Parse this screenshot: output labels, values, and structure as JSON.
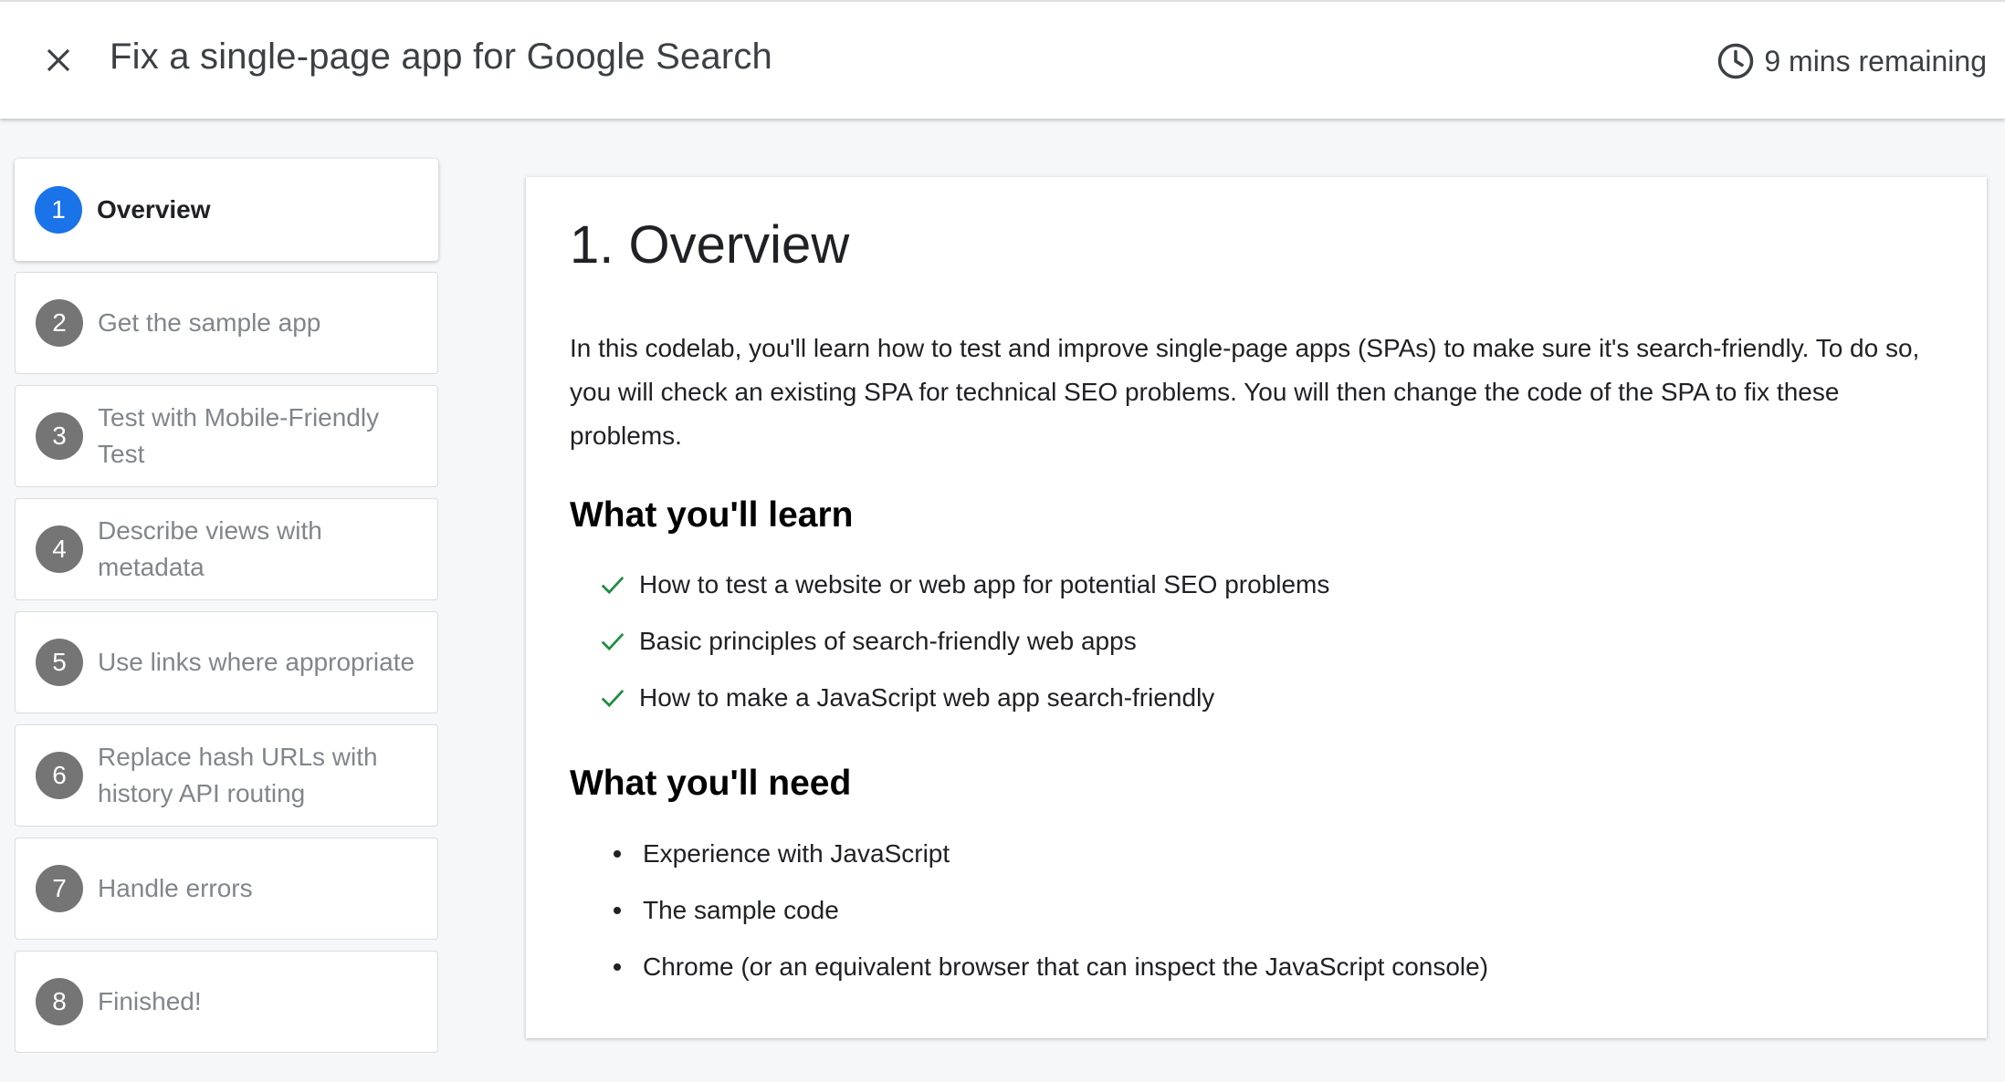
{
  "header": {
    "title": "Fix a single-page app for Google Search",
    "timer_text": "9 mins remaining",
    "close_icon": "close-icon",
    "clock_icon": "clock-icon"
  },
  "sidebar": {
    "steps": [
      {
        "number": "1",
        "label": "Overview",
        "active": true
      },
      {
        "number": "2",
        "label": "Get the sample app"
      },
      {
        "number": "3",
        "label": "Test with Mobile-Friendly Test"
      },
      {
        "number": "4",
        "label": "Describe views with metadata"
      },
      {
        "number": "5",
        "label": "Use links where appropriate"
      },
      {
        "number": "6",
        "label": "Replace hash URLs with history API routing"
      },
      {
        "number": "7",
        "label": "Handle errors"
      },
      {
        "number": "8",
        "label": "Finished!"
      }
    ]
  },
  "content": {
    "heading": "1. Overview",
    "intro": "In this codelab, you'll learn how to test and improve single-page apps (SPAs) to make sure it's search-friendly. To do so, you will check an existing SPA for technical SEO problems. You will then change the code of the SPA to fix these problems.",
    "learn_heading": "What you'll learn",
    "learn_items": [
      "How to test a website or web app for potential SEO problems",
      "Basic principles of search-friendly web apps",
      "How to make a JavaScript web app search-friendly"
    ],
    "need_heading": "What you'll need",
    "need_items": [
      "Experience with JavaScript",
      "The sample code",
      "Chrome (or an equivalent browser that can inspect the JavaScript console)"
    ]
  },
  "colors": {
    "active_step": "#1a73e8",
    "inactive_step": "#757575",
    "check": "#1e8e3e"
  }
}
